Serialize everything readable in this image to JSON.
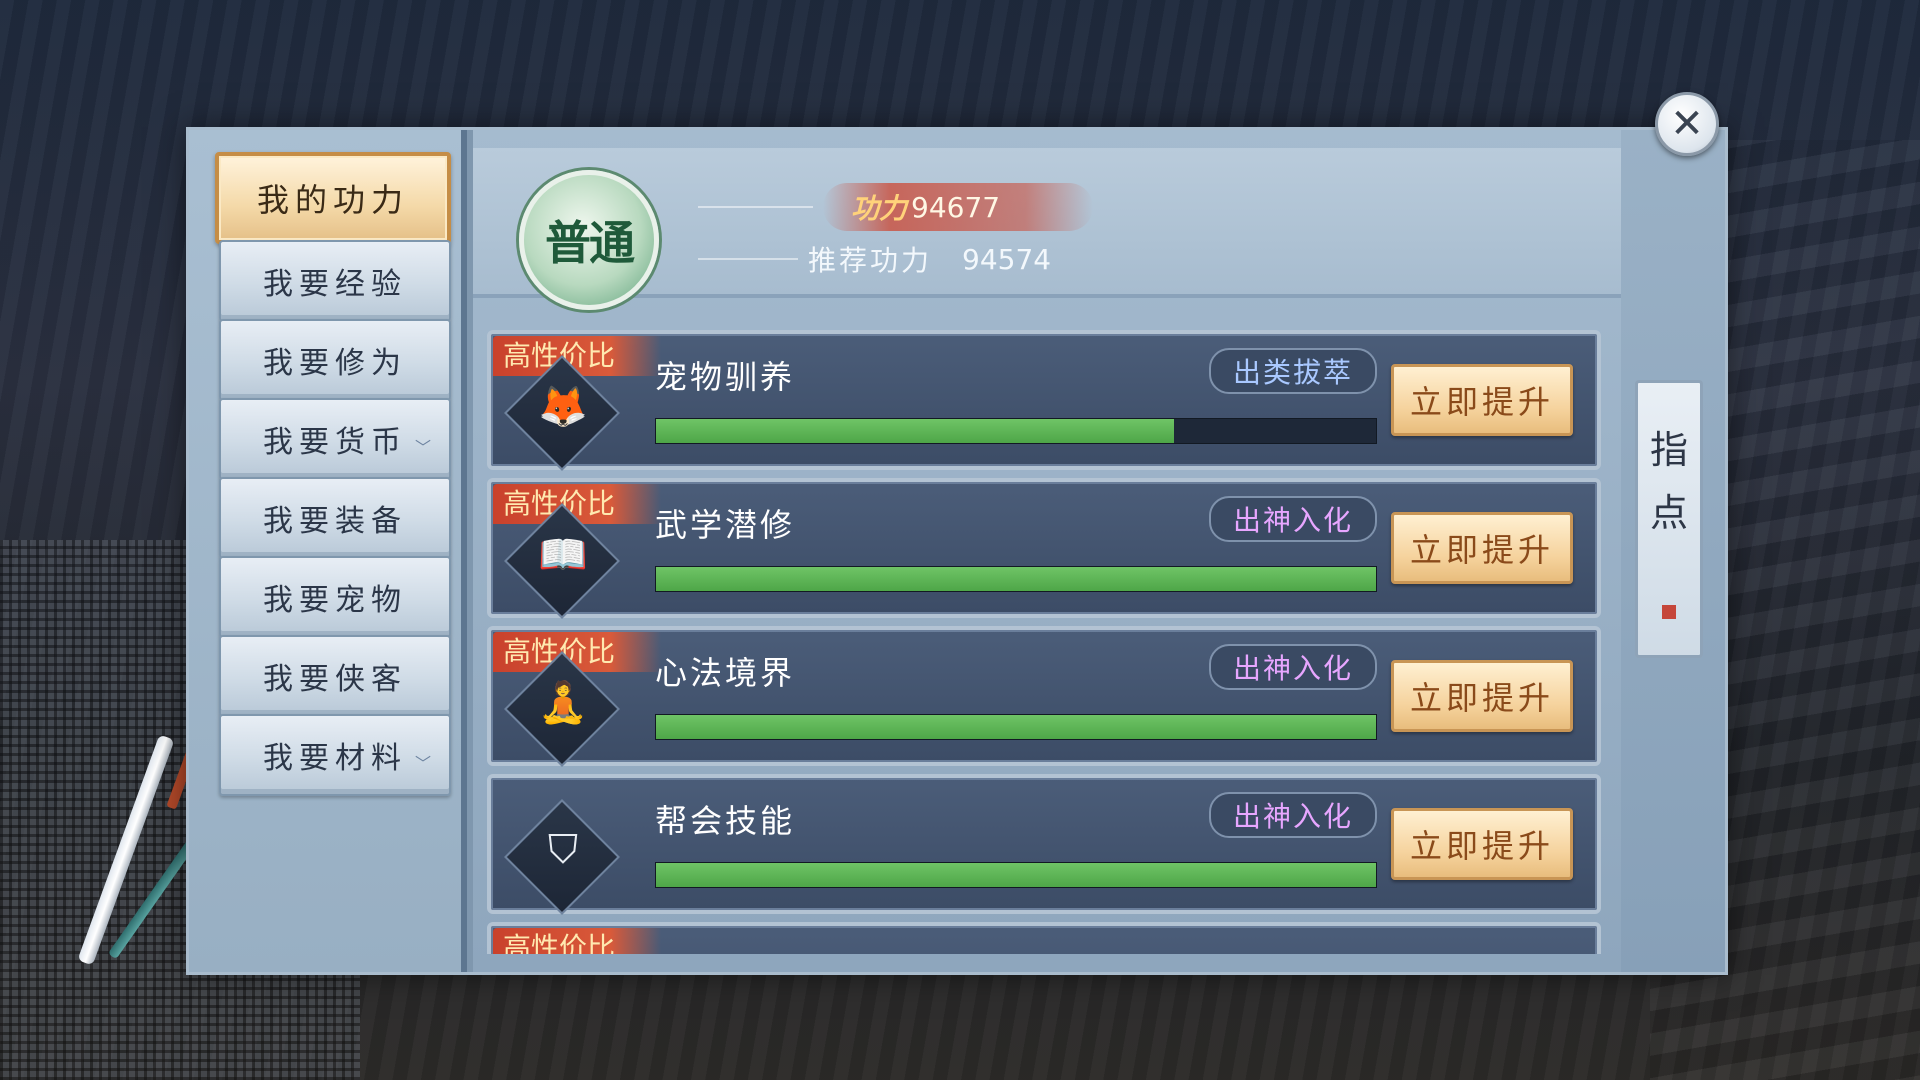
{
  "sidebar": {
    "items": [
      {
        "label": "我的功力",
        "active": true,
        "dropdown": false
      },
      {
        "label": "我要经验",
        "active": false,
        "dropdown": false
      },
      {
        "label": "我要修为",
        "active": false,
        "dropdown": false
      },
      {
        "label": "我要货币",
        "active": false,
        "dropdown": true
      },
      {
        "label": "我要装备",
        "active": false,
        "dropdown": false
      },
      {
        "label": "我要宠物",
        "active": false,
        "dropdown": false
      },
      {
        "label": "我要侠客",
        "active": false,
        "dropdown": false
      },
      {
        "label": "我要材料",
        "active": false,
        "dropdown": true
      }
    ]
  },
  "header": {
    "rank_badge": "普通",
    "power_label": "功力",
    "power_value": "94677",
    "recommended_label": "推荐功力",
    "recommended_value": "94574"
  },
  "rows": [
    {
      "tag": "高性价比",
      "title": "宠物驯养",
      "grade": "出类拔萃",
      "grade_color": "#a9c8ff",
      "progress": 0.72,
      "button": "立即提升",
      "icon": "fox-icon",
      "glyph": "🦊"
    },
    {
      "tag": "高性价比",
      "title": "武学潜修",
      "grade": "出神入化",
      "grade_color": "#e7a6ff",
      "progress": 1.0,
      "button": "立即提升",
      "icon": "book-icon",
      "glyph": "📖"
    },
    {
      "tag": "高性价比",
      "title": "心法境界",
      "grade": "出神入化",
      "grade_color": "#e7a6ff",
      "progress": 1.0,
      "button": "立即提升",
      "icon": "meditation-icon",
      "glyph": "🧘"
    },
    {
      "tag": "",
      "title": "帮会技能",
      "grade": "出神入化",
      "grade_color": "#e7a6ff",
      "progress": 1.0,
      "button": "立即提升",
      "icon": "banner-icon",
      "glyph": "⛉"
    },
    {
      "tag": "高性价比",
      "title": "",
      "grade": "",
      "grade_color": "#e7a6ff",
      "progress": 0,
      "button": "",
      "icon": "",
      "glyph": ""
    }
  ],
  "guide": {
    "label_1": "指",
    "label_2": "点"
  },
  "close": {
    "glyph": "✕"
  },
  "colors": {
    "accent_gold": "#f5d29c",
    "progress_green": "#5cb455",
    "tag_red": "#d0462f"
  }
}
